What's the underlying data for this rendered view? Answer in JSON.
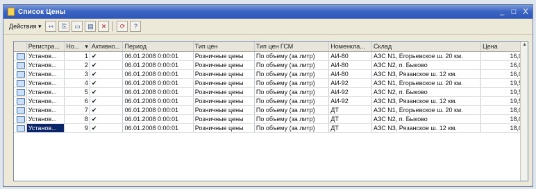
{
  "window": {
    "title": "Список Цены",
    "controls": {
      "minimize": "_",
      "maximize": "□",
      "close": "X"
    }
  },
  "toolbar": {
    "actions_label": "Действия",
    "dropdown_arrow": "▾",
    "icons": [
      "edit-icon",
      "copy-icon",
      "paste-icon",
      "list-view-icon",
      "delete-icon",
      "refresh-icon",
      "help-icon"
    ],
    "help_label": "?"
  },
  "table": {
    "columns": [
      "",
      "Регистра...",
      "Но...",
      "Активно...",
      "Период",
      "Тип цен",
      "Тип цен ГСМ",
      "Номенкла...",
      "Склад",
      "Цена"
    ],
    "sort_marker": "▾",
    "rows": [
      {
        "reg": "Установ...",
        "no": "1",
        "active": "✔",
        "period": "06.01.2008 0:00:01",
        "price_type": "Розничные цены",
        "fuel_price_type": "По объему (за литр)",
        "item": "АИ-80",
        "warehouse": "АЗС N1, Егорьевское ш. 20 км.",
        "price": "16,00"
      },
      {
        "reg": "Установ...",
        "no": "2",
        "active": "✔",
        "period": "06.01.2008 0:00:01",
        "price_type": "Розничные цены",
        "fuel_price_type": "По объему (за литр)",
        "item": "АИ-80",
        "warehouse": "АЗС N2, п. Быково",
        "price": "16,00"
      },
      {
        "reg": "Установ...",
        "no": "3",
        "active": "✔",
        "period": "06.01.2008 0:00:01",
        "price_type": "Розничные цены",
        "fuel_price_type": "По объему (за литр)",
        "item": "АИ-80",
        "warehouse": "АЗС N3, Рязанское ш. 12 км.",
        "price": "16,00"
      },
      {
        "reg": "Установ...",
        "no": "4",
        "active": "✔",
        "period": "06.01.2008 0:00:01",
        "price_type": "Розничные цены",
        "fuel_price_type": "По объему (за литр)",
        "item": "АИ-92",
        "warehouse": "АЗС N1, Егорьевское ш. 20 км.",
        "price": "19,50"
      },
      {
        "reg": "Установ...",
        "no": "5",
        "active": "✔",
        "period": "06.01.2008 0:00:01",
        "price_type": "Розничные цены",
        "fuel_price_type": "По объему (за литр)",
        "item": "АИ-92",
        "warehouse": "АЗС N2, п. Быково",
        "price": "19,50"
      },
      {
        "reg": "Установ...",
        "no": "6",
        "active": "✔",
        "period": "06.01.2008 0:00:01",
        "price_type": "Розничные цены",
        "fuel_price_type": "По объему (за литр)",
        "item": "АИ-92",
        "warehouse": "АЗС N3, Рязанское ш. 12 км.",
        "price": "19,50"
      },
      {
        "reg": "Установ...",
        "no": "7",
        "active": "✔",
        "period": "06.01.2008 0:00:01",
        "price_type": "Розничные цены",
        "fuel_price_type": "По объему (за литр)",
        "item": "ДТ",
        "warehouse": "АЗС N1, Егорьевское ш. 20 км.",
        "price": "18,00"
      },
      {
        "reg": "Установ...",
        "no": "8",
        "active": "✔",
        "period": "06.01.2008 0:00:01",
        "price_type": "Розничные цены",
        "fuel_price_type": "По объему (за литр)",
        "item": "ДТ",
        "warehouse": "АЗС N2, п. Быково",
        "price": "18,00"
      },
      {
        "reg": "Установ...",
        "no": "9",
        "active": "✔",
        "period": "06.01.2008 0:00:01",
        "price_type": "Розничные цены",
        "fuel_price_type": "По объему (за литр)",
        "item": "ДТ",
        "warehouse": "АЗС N3, Рязанское ш. 12 км.",
        "price": "18,00",
        "selected": true
      }
    ]
  },
  "colors": {
    "titlebar": "#3d66c4",
    "selection": "#0a246a"
  }
}
